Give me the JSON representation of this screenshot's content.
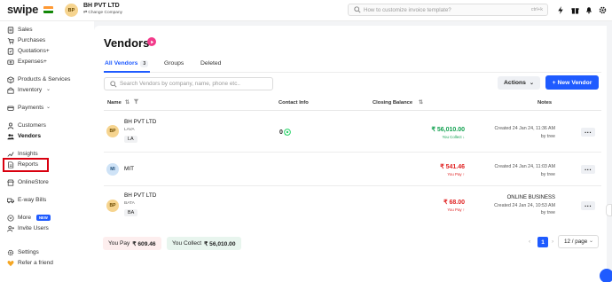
{
  "topbar": {
    "logo": "swipe",
    "company_initials": "BP",
    "company_name": "BH PVT LTD",
    "company_change": "Change Company",
    "search_placeholder": "How to customize invoice template?",
    "search_shortcut": "ctrl+k",
    "icons": [
      "bolt-icon",
      "gift-icon",
      "bell-icon",
      "gear-icon"
    ]
  },
  "sidebar": {
    "items": [
      {
        "label": "Sales",
        "icon": "sales-icon"
      },
      {
        "label": "Purchases",
        "icon": "purchases-icon"
      },
      {
        "label": "Quotations+",
        "icon": "quotations-icon"
      },
      {
        "label": "Expenses+",
        "icon": "expenses-icon"
      },
      {
        "label": "Products & Services",
        "icon": "box-icon"
      },
      {
        "label": "Inventory",
        "icon": "inventory-icon"
      },
      {
        "label": "Payments",
        "icon": "payments-icon"
      },
      {
        "label": "Customers",
        "icon": "person-icon"
      },
      {
        "label": "Vendors",
        "icon": "vendors-icon"
      },
      {
        "label": "Insights",
        "icon": "insights-icon"
      },
      {
        "label": "Reports",
        "icon": "reports-icon"
      },
      {
        "label": "OnlineStore",
        "icon": "store-icon"
      },
      {
        "label": "E-way Bills",
        "icon": "truck-icon"
      },
      {
        "label": "More",
        "icon": "more-icon",
        "badge": "NEW"
      },
      {
        "label": "Invite Users",
        "icon": "invite-icon"
      },
      {
        "label": "Settings",
        "icon": "gear-icon"
      },
      {
        "label": "Refer a friend",
        "icon": "heart-icon"
      }
    ]
  },
  "main": {
    "title": "Vendors",
    "tabs": [
      {
        "label": "All Vendors",
        "count": "3"
      },
      {
        "label": "Groups"
      },
      {
        "label": "Deleted"
      }
    ],
    "search_placeholder": "Search Vendors by company, name, phone etc..",
    "actions_label": "Actions",
    "new_button_label": "+ New Vendor",
    "columns": {
      "name": "Name",
      "contact": "Contact Info",
      "balance": "Closing Balance",
      "notes": "Notes"
    },
    "rows": [
      {
        "initials": "BP",
        "avatar_color": "#f6d48f",
        "name": "BH PVT LTD",
        "sub": "LAVA",
        "tag": "LA",
        "contact": "0",
        "balance": "₹ 56,010.00",
        "balance_note": "You Collect ↓",
        "balance_color": "green",
        "note_title": "",
        "note_line1": "Created 24 Jan 24, 11:36 AM",
        "note_line2": "by tree"
      },
      {
        "initials": "MI",
        "avatar_color": "#cfe3f7",
        "name": "MIT",
        "sub": "",
        "tag": "",
        "contact": "",
        "balance": "₹ 541.46",
        "balance_note": "You Pay ↑",
        "balance_color": "red",
        "note_title": "",
        "note_line1": "Created 24 Jan 24, 11:03 AM",
        "note_line2": "by tree"
      },
      {
        "initials": "BP",
        "avatar_color": "#f6d48f",
        "name": "BH PVT LTD",
        "sub": "BATA",
        "tag": "BA",
        "contact": "",
        "balance": "₹ 68.00",
        "balance_note": "You Pay ↑",
        "balance_color": "red",
        "note_title": "ONLINE BUSINESS",
        "note_line1": "Created 24 Jan 24, 10:53 AM",
        "note_line2": "by tree"
      }
    ],
    "summary": {
      "pay_label": "You Pay",
      "pay_value": "₹ 609.46",
      "collect_label": "You Collect",
      "collect_value": "₹ 56,010.00"
    },
    "pagination": {
      "current": "1",
      "per_page": "12 / page"
    }
  }
}
